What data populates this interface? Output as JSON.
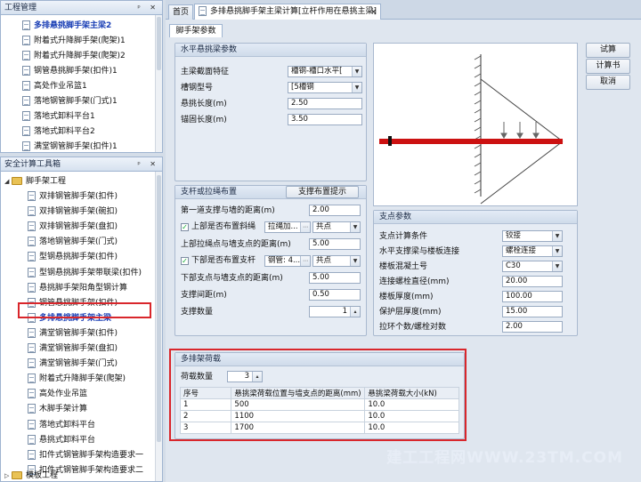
{
  "project_panel": {
    "title": "工程管理",
    "pin": "ᵖ",
    "close": "✕",
    "items": [
      {
        "label": "多排悬挑脚手架主梁2",
        "selected": true
      },
      {
        "label": "附着式升降脚手架(爬架)1"
      },
      {
        "label": "附着式升降脚手架(爬架)2"
      },
      {
        "label": "钢管悬挑脚手架(扣件)1"
      },
      {
        "label": "高处作业吊篮1"
      },
      {
        "label": "落地钢管脚手架(门式)1"
      },
      {
        "label": "落地式卸料平台1"
      },
      {
        "label": "落地式卸料平台2"
      },
      {
        "label": "满堂钢管脚手架(扣件)1"
      }
    ]
  },
  "toolbox_panel": {
    "title": "安全计算工具箱",
    "pin": "ᵖ",
    "close": "✕",
    "root": "脚手架工程",
    "items": [
      {
        "label": "双排钢管脚手架(扣件)"
      },
      {
        "label": "双排钢管脚手架(碗扣)"
      },
      {
        "label": "双排钢管脚手架(盘扣)"
      },
      {
        "label": "落地钢管脚手架(门式)"
      },
      {
        "label": "型钢悬挑脚手架(扣件)"
      },
      {
        "label": "型钢悬挑脚手架带联梁(扣件)"
      },
      {
        "label": "悬挑脚手架阳角型钢计算"
      },
      {
        "label": "钢管悬挑脚手架(扣件)"
      },
      {
        "label": "多排悬挑脚手架主梁",
        "highlight": true
      },
      {
        "label": "满堂钢管脚手架(扣件)"
      },
      {
        "label": "满堂钢管脚手架(盘扣)"
      },
      {
        "label": "满堂钢管脚手架(门式)"
      },
      {
        "label": "附着式升降脚手架(爬架)"
      },
      {
        "label": "高处作业吊篮"
      },
      {
        "label": "木脚手架计算"
      },
      {
        "label": "落地式卸料平台"
      },
      {
        "label": "悬挑式卸料平台"
      },
      {
        "label": "扣件式钢管脚手架构造要求一"
      },
      {
        "label": "扣件式钢管脚手架构造要求二"
      }
    ],
    "bottom_root": "模板工程"
  },
  "tabs": [
    {
      "label": "首页"
    },
    {
      "label": "多排悬挑脚手架主梁计算[立杆作用在悬挑主梁]",
      "active": true,
      "close": "✕"
    }
  ],
  "subtab": "脚手架参数",
  "actions": {
    "calc": "试算",
    "report": "计算书",
    "cancel": "取消"
  },
  "beam_group": {
    "title": "水平悬挑梁参数",
    "fields": [
      {
        "label": "主梁截面特征",
        "value": "槽钢-槽口水平[",
        "dropdown": true
      },
      {
        "label": "槽钢型号",
        "value": "[5槽钢",
        "dropdown": true
      },
      {
        "label": "悬挑长度(m)",
        "value": "2.50"
      },
      {
        "label": "锚固长度(m)",
        "value": "3.50"
      }
    ]
  },
  "support_group": {
    "title": "支杆或拉绳布置",
    "hint_button": "支撑布置提示",
    "first_dist_label": "第一道支撑与墙的距离(m)",
    "first_dist": "2.00",
    "upper_check_label": "上部是否布置斜绳",
    "upper_type": "拉绳加...",
    "upper_ellipsis": "⋯",
    "upper_point": "共点",
    "upper_dist_label": "上部拉绳点与墙支点的距离(m)",
    "upper_dist": "5.00",
    "lower_check_label": "下部是否布置支杆",
    "lower_type": "钢管: 4...",
    "lower_ellipsis": "⋯",
    "lower_point": "共点",
    "lower_dist_label": "下部支点与墙支点的距离(m)",
    "lower_dist": "5.00",
    "spacing_label": "支撑间距(m)",
    "spacing": "0.50",
    "count_label": "支撑数量",
    "count": "1",
    "check_mark": "✓"
  },
  "pivot_group": {
    "title": "支点参数",
    "fields": [
      {
        "label": "支点计算条件",
        "value": "铰接",
        "dropdown": true
      },
      {
        "label": "水平支撑梁与楼板连接",
        "value": "螺栓连接",
        "dropdown": true
      },
      {
        "label": "楼板混凝土号",
        "value": "C30",
        "dropdown": true
      },
      {
        "label": "连接螺栓直径(mm)",
        "value": "20.00"
      },
      {
        "label": "楼板厚度(mm)",
        "value": "100.00"
      },
      {
        "label": "保护层厚度(mm)",
        "value": "15.00"
      },
      {
        "label": "拉环个数/螺栓对数",
        "value": "2.00"
      }
    ]
  },
  "load_group": {
    "title": "多排架荷载",
    "count_label": "荷载数量",
    "count": "3",
    "columns": [
      "序号",
      "悬挑梁荷载位置与墙支点的距离(mm)",
      "悬挑梁荷载大小(kN)"
    ],
    "rows": [
      [
        "1",
        "500",
        "10.0"
      ],
      [
        "2",
        "1100",
        "10.0"
      ],
      [
        "3",
        "1700",
        "10.0"
      ]
    ]
  },
  "watermark": "建工工程网WWW.23TM.COM",
  "colors": {
    "highlight_border": "#d9262b",
    "beam": "#cc1111",
    "selected_text": "#1a3fb5"
  }
}
